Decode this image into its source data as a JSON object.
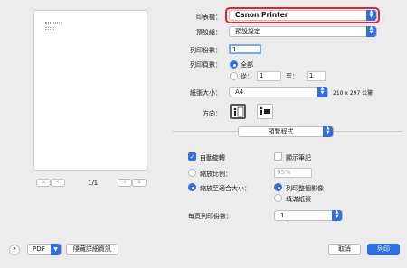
{
  "preview": {
    "page_counter": "1/1",
    "nav_first": "«",
    "nav_prev": "‹",
    "nav_next": "›",
    "nav_last": "»"
  },
  "printer": {
    "label": "印表機：",
    "value": "Canon Printer"
  },
  "presets": {
    "label": "預設組：",
    "value": "預設設定"
  },
  "copies": {
    "label": "列印份數：",
    "value": "1"
  },
  "pages": {
    "label": "列印頁數：",
    "all_label": "全部",
    "from_label": "從：",
    "from_value": "1",
    "to_label": "至：",
    "to_value": "1"
  },
  "paper_size": {
    "label": "紙張大小：",
    "value": "A4",
    "dimensions": "210 x 297 公釐"
  },
  "orientation": {
    "label": "方向："
  },
  "section": {
    "value": "預覽程式"
  },
  "auto_rotate": {
    "label": "自動旋轉",
    "checked": true
  },
  "show_notes": {
    "label": "顯示筆記",
    "checked": false
  },
  "scale": {
    "label": "縮放比例：",
    "value": "95%"
  },
  "scale_to_fit": {
    "label": "縮放至適合大小：",
    "print_entire": "列印整個影像",
    "fill_paper": "填滿紙張"
  },
  "pages_per_sheet": {
    "label": "每頁列印份數：",
    "value": "1"
  },
  "footer": {
    "help": "?",
    "pdf": "PDF",
    "hide_details": "隱藏詳細資訊",
    "cancel": "取消",
    "print": "列印"
  },
  "colors": {
    "accent": "#2f6fe3",
    "focus_ring": "#d9252e"
  }
}
